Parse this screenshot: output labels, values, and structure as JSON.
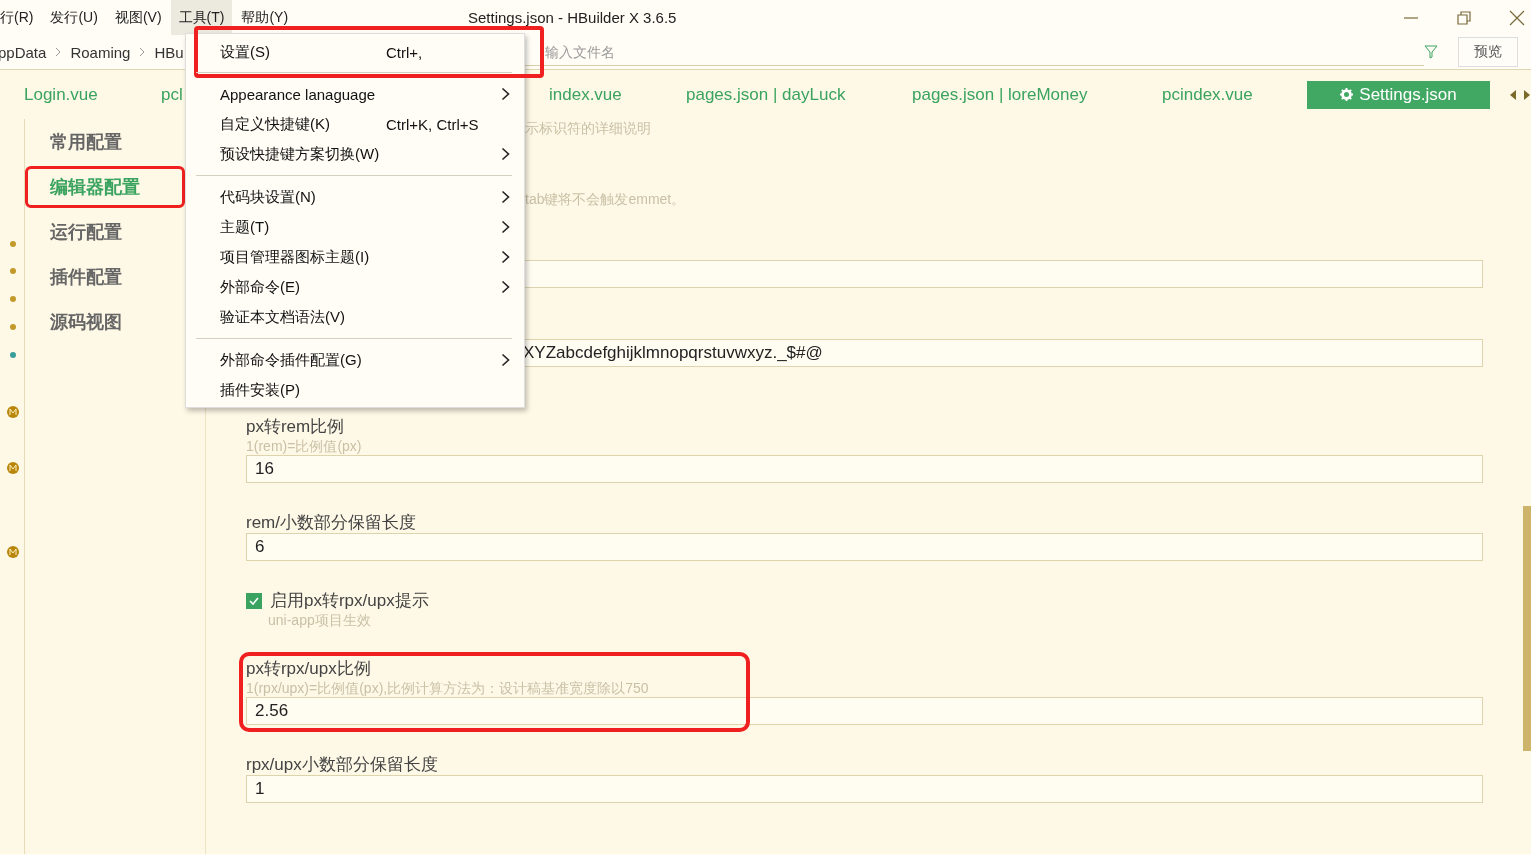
{
  "window": {
    "title": "Settings.json - HBuilder X 3.6.5"
  },
  "menubar": [
    {
      "label": "行(R)",
      "selected": false
    },
    {
      "label": "发行(U)",
      "selected": false
    },
    {
      "label": "视图(V)",
      "selected": false
    },
    {
      "label": "工具(T)",
      "selected": true
    },
    {
      "label": "帮助(Y)",
      "selected": false
    }
  ],
  "breadcrumbs": [
    "ppData",
    "Roaming",
    "HBu"
  ],
  "file_search": {
    "placeholder": "输入文件名"
  },
  "preview_button": "预览",
  "tabs": [
    {
      "label": "Login.vue",
      "selected": false
    },
    {
      "label": "pcl",
      "selected": false
    },
    {
      "label": "index.vue",
      "selected": false
    },
    {
      "label": "pages.json | dayLuck",
      "selected": false
    },
    {
      "label": "pages.json | loreMoney",
      "selected": false
    },
    {
      "label": "pcindex.vue",
      "selected": false
    },
    {
      "label": "Settings.json",
      "selected": true
    }
  ],
  "sidebar": {
    "items": [
      {
        "label": "常用配置",
        "selected": false,
        "highlighted": false
      },
      {
        "label": "编辑器配置",
        "selected": true,
        "highlighted": true
      },
      {
        "label": "运行配置",
        "selected": false,
        "highlighted": false
      },
      {
        "label": "插件配置",
        "selected": false,
        "highlighted": false
      },
      {
        "label": "源码视图",
        "selected": false,
        "highlighted": false
      }
    ]
  },
  "settings_partial": [
    {
      "kind": "hint",
      "text": "示标识符的详细说明"
    },
    {
      "kind": "hint",
      "text": "tab键将不会触发emmet。"
    },
    {
      "kind": "field"
    },
    {
      "kind": "field",
      "value": "XYZabcdefghijklmnopqrstuvwxyz._$#@"
    }
  ],
  "settings": [
    {
      "kind": "number",
      "label": "px转rem比例",
      "hint": "1(rem)=比例值(px)",
      "value": "16",
      "highlighted": false
    },
    {
      "kind": "number",
      "label": "rem/小数部分保留长度",
      "value": "6",
      "highlighted": false
    },
    {
      "kind": "checkbox",
      "label": "启用px转rpx/upx提示",
      "hint": "uni-app项目生效",
      "checked": true
    },
    {
      "kind": "number",
      "label": "px转rpx/upx比例",
      "hint": "1(rpx/upx)=比例值(px),比例计算方法为：设计稿基准宽度除以750",
      "value": "2.56",
      "highlighted": true
    },
    {
      "kind": "number",
      "label": "rpx/upx小数部分保留长度",
      "value": "1",
      "highlighted": false
    }
  ],
  "menu": [
    {
      "kind": "item",
      "label": "设置(S)",
      "shortcut": "Ctrl+,",
      "submenu": false,
      "highlighted": true
    },
    {
      "kind": "separator"
    },
    {
      "kind": "item",
      "label": "Appearance lanaguage",
      "submenu": true,
      "highlighted": false
    },
    {
      "kind": "item",
      "label": "自定义快捷键(K)",
      "shortcut": "Ctrl+K, Ctrl+S",
      "submenu": false,
      "highlighted": false
    },
    {
      "kind": "item",
      "label": "预设快捷键方案切换(W)",
      "submenu": true,
      "highlighted": false
    },
    {
      "kind": "separator"
    },
    {
      "kind": "item",
      "label": "代码块设置(N)",
      "submenu": true,
      "highlighted": false
    },
    {
      "kind": "item",
      "label": "主题(T)",
      "submenu": true,
      "highlighted": false
    },
    {
      "kind": "item",
      "label": "项目管理器图标主题(I)",
      "submenu": true,
      "highlighted": false
    },
    {
      "kind": "item",
      "label": "外部命令(E)",
      "submenu": true,
      "highlighted": false
    },
    {
      "kind": "item",
      "label": "验证本文档语法(V)",
      "submenu": false,
      "highlighted": false
    },
    {
      "kind": "separator"
    },
    {
      "kind": "item",
      "label": "外部命令插件配置(G)",
      "submenu": true,
      "highlighted": false
    },
    {
      "kind": "item",
      "label": "插件安装(P)",
      "submenu": false,
      "highlighted": false
    }
  ]
}
